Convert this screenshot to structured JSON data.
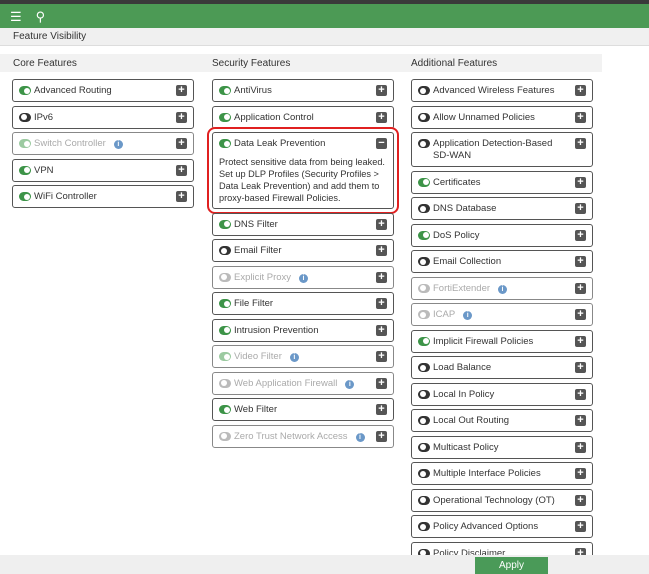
{
  "header": {
    "menu_icon": "☰",
    "search_icon": "⚲"
  },
  "page_title": "Feature Visibility",
  "columns": [
    {
      "title": "Core Features",
      "items": [
        {
          "label": "Advanced Routing",
          "on": true
        },
        {
          "label": "IPv6",
          "on": false
        },
        {
          "label": "Switch Controller",
          "on": true,
          "disabled": true,
          "info": true
        },
        {
          "label": "VPN",
          "on": true
        },
        {
          "label": "WiFi Controller",
          "on": true
        }
      ]
    },
    {
      "title": "Security Features",
      "items": [
        {
          "label": "AntiVirus",
          "on": true
        },
        {
          "label": "Application Control",
          "on": true
        },
        {
          "label": "Data Leak Prevention",
          "on": true,
          "expanded": true,
          "highlighted": true,
          "description": "Protect sensitive data from being leaked. Set up DLP Profiles (Security Profiles > Data Leak Prevention) and add them to proxy-based Firewall Policies."
        },
        {
          "label": "DNS Filter",
          "on": true
        },
        {
          "label": "Email Filter",
          "on": false
        },
        {
          "label": "Explicit Proxy",
          "on": false,
          "disabled": true,
          "info": true
        },
        {
          "label": "File Filter",
          "on": true
        },
        {
          "label": "Intrusion Prevention",
          "on": true
        },
        {
          "label": "Video Filter",
          "on": true,
          "disabled": true,
          "info": true
        },
        {
          "label": "Web Application Firewall",
          "on": false,
          "disabled": true,
          "info": true
        },
        {
          "label": "Web Filter",
          "on": true
        },
        {
          "label": "Zero Trust Network Access",
          "on": false,
          "disabled": true,
          "info": true
        }
      ]
    },
    {
      "title": "Additional Features",
      "items": [
        {
          "label": "Advanced Wireless Features",
          "on": false
        },
        {
          "label": "Allow Unnamed Policies",
          "on": false
        },
        {
          "label": "Application Detection-Based SD-WAN",
          "on": false
        },
        {
          "label": "Certificates",
          "on": true
        },
        {
          "label": "DNS Database",
          "on": false
        },
        {
          "label": "DoS Policy",
          "on": true
        },
        {
          "label": "Email Collection",
          "on": false
        },
        {
          "label": "FortiExtender",
          "on": false,
          "disabled": true,
          "info": true
        },
        {
          "label": "ICAP",
          "on": false,
          "disabled": true,
          "info": true
        },
        {
          "label": "Implicit Firewall Policies",
          "on": true
        },
        {
          "label": "Load Balance",
          "on": false
        },
        {
          "label": "Local In Policy",
          "on": false
        },
        {
          "label": "Local Out Routing",
          "on": false
        },
        {
          "label": "Multicast Policy",
          "on": false
        },
        {
          "label": "Multiple Interface Policies",
          "on": false
        },
        {
          "label": "Operational Technology (OT)",
          "on": false
        },
        {
          "label": "Policy Advanced Options",
          "on": false
        },
        {
          "label": "Policy Disclaimer",
          "on": false
        },
        {
          "label": "",
          "on": false
        }
      ]
    }
  ],
  "apply_label": "Apply",
  "colors": {
    "brand": "#4c9a55",
    "highlight": "#e02020"
  }
}
